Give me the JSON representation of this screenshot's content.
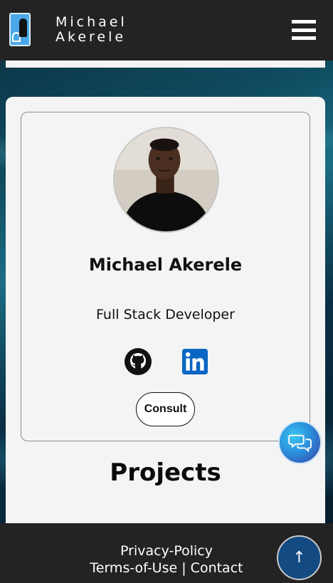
{
  "header": {
    "brand_line1": "Michael",
    "brand_line2": "Akerele",
    "logo_icon": "ma-logo-icon",
    "menu_icon": "hamburger-menu-icon"
  },
  "profile": {
    "name": "Michael Akerele",
    "role": "Full Stack Developer",
    "social": [
      {
        "icon": "github-icon"
      },
      {
        "icon": "linkedin-icon"
      }
    ],
    "consult_label": "Consult"
  },
  "sections": {
    "projects_heading": "Projects"
  },
  "footer": {
    "privacy": "Privacy-Policy",
    "terms": "Terms-of-Use",
    "separator": " | ",
    "contact": "Contact"
  },
  "floating": {
    "chat_icon": "chat-bubbles-icon",
    "back_to_top_label": "↑"
  },
  "colors": {
    "header_bg": "#232323",
    "card_bg": "#f4f4f4",
    "linkedin_blue": "#0a66c2",
    "back_to_top_bg": "#134a82"
  }
}
